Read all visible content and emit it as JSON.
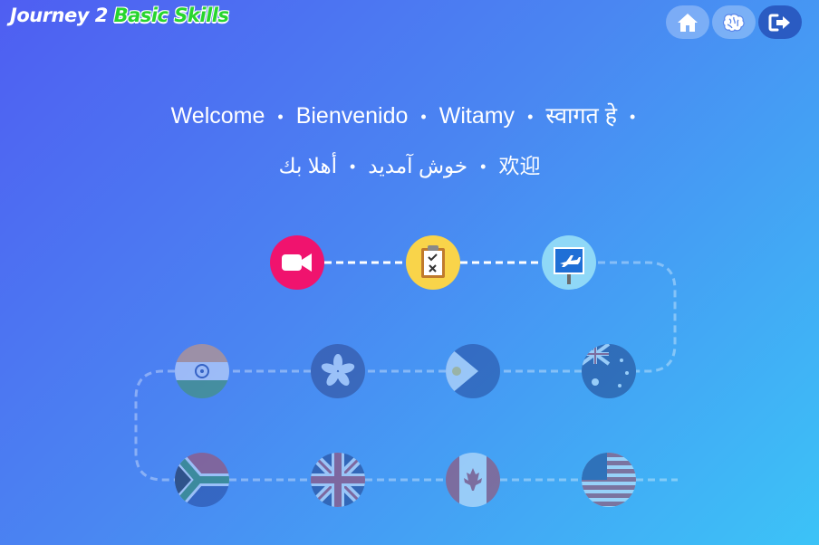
{
  "logo": {
    "part1": "Journey 2",
    "part2": "Basic Skills"
  },
  "nav": {
    "home_icon": "home-icon",
    "brain_icon": "brain-icon",
    "exit_icon": "exit-icon"
  },
  "welcome": {
    "line1": [
      "Welcome",
      "Bienvenido",
      "Witamy",
      "स्वागत हे"
    ],
    "line1_trailing_dot": "•",
    "line2": [
      "خوش آمدید",
      "أهلا بك",
      "欢迎"
    ],
    "separator": "•"
  },
  "levels": [
    {
      "name": "video",
      "icon": "video-camera-icon",
      "state": "active",
      "color": "#f0136e"
    },
    {
      "name": "checklist",
      "icon": "clipboard-checklist-icon",
      "state": "active",
      "color": "#f9d44a"
    },
    {
      "name": "airport",
      "icon": "airplane-sign-icon",
      "state": "active",
      "color": "#8fd8f7"
    },
    {
      "name": "australia",
      "icon": "australia-flag-icon",
      "state": "locked"
    },
    {
      "name": "philippines",
      "icon": "philippines-flag-icon",
      "state": "locked"
    },
    {
      "name": "hong-kong",
      "icon": "hong-kong-flag-icon",
      "state": "locked"
    },
    {
      "name": "india",
      "icon": "india-flag-icon",
      "state": "locked"
    },
    {
      "name": "south-africa",
      "icon": "south-africa-flag-icon",
      "state": "locked"
    },
    {
      "name": "united-kingdom",
      "icon": "uk-flag-icon",
      "state": "locked"
    },
    {
      "name": "canada",
      "icon": "canada-flag-icon",
      "state": "locked"
    },
    {
      "name": "united-states",
      "icon": "us-flag-icon",
      "state": "locked"
    }
  ]
}
